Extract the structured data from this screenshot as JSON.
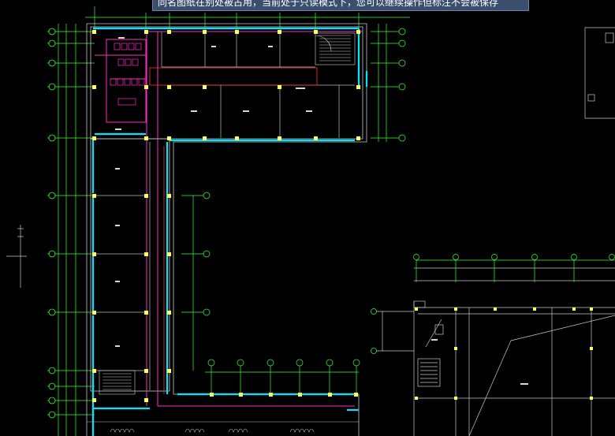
{
  "banner": {
    "message": "同名图纸在别处被占用，当前处于只读模式下，您可以继续操作但标注不会被保存"
  },
  "colors": {
    "background": "#000000",
    "wall": "#00e5ff",
    "column": "#ffff66",
    "outline": "#c8c8c8",
    "grid_line": "#33ff33",
    "pipe": "#ff2ec4",
    "red_line": "#ff3030",
    "banner_bg": "#3a4e6e"
  }
}
